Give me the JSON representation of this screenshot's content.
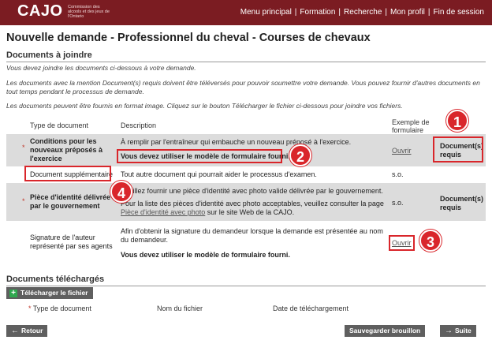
{
  "header": {
    "logo": "CAJO",
    "logo_sub": "Commission des alcools et des jeux de l'Ontario",
    "nav": [
      "Menu principal",
      "Formation",
      "Recherche",
      "Mon profil",
      "Fin de session"
    ],
    "separator": "|"
  },
  "page_title": "Nouvelle demande - Professionnel du cheval - Courses de chevaux",
  "documents": {
    "section_title": "Documents à joindre",
    "intro1": "Vous devez joindre les documents ci-dessous à votre demande.",
    "intro2": "Les documents avec la mention Document(s) requis doivent être téléversés pour pouvoir soumettre votre demande. Vous pouvez fournir d'autres documents en tout temps pendant le processus de demande.",
    "intro3": "Les documents peuvent être fournis en format image. Cliquez sur le bouton Télécharger le fichier ci-dessous pour joindre vos fichiers.",
    "headers": {
      "type": "Type de document",
      "description": "Description",
      "example": "Exemple de formulaire"
    },
    "rows": [
      {
        "star": "*",
        "type": "Conditions pour les nouveaux préposés à l'exercice",
        "desc1": "À remplir par l'entraîneur qui embauche un nouveau préposé à l'exercice.",
        "desc2": "Vous devez utiliser le modèle de formulaire fourni.",
        "example": "Ouvrir",
        "status": "Document(s) requis"
      },
      {
        "type": "Document supplémentaire",
        "desc1": "Tout autre document qui pourrait aider le processus d'examen.",
        "example": "s.o."
      },
      {
        "star": "*",
        "type": "Pièce d'identité délivrée par le gouvernement",
        "desc1": "Veuillez fournir une pièce d'identité avec photo valide délivrée par le gouvernement.",
        "desc2a": "Pour la liste des pièces d'identité avec photo acceptables, veuillez consulter la page ",
        "desc2_link": "Pièce d'identité avec photo",
        "desc2b": " sur le site Web de la CAJO.",
        "example": "s.o.",
        "status": "Document(s) requis"
      },
      {
        "type": "Signature de l'auteur représenté par ses agents",
        "desc1": "Afin d'obtenir la signature du demandeur lorsque la demande est présentée au nom du demandeur.",
        "desc2": "Vous devez utiliser le modèle de formulaire fourni.",
        "example": "Ouvrir"
      }
    ]
  },
  "uploaded": {
    "section_title": "Documents téléchargés",
    "upload_button": "Télécharger le fichier",
    "headers": {
      "star": "*",
      "type": "Type de document",
      "filename": "Nom du fichier",
      "date": "Date de téléchargement"
    }
  },
  "footer": {
    "back": "Retour",
    "save": "Sauvegarder brouillon",
    "next": "Suite"
  },
  "badges": [
    "1",
    "2",
    "3",
    "4"
  ],
  "colors": {
    "header_bg": "#7b1c22",
    "highlight": "#d9262b",
    "button_bg": "#5f5f5f",
    "row_gray": "#dcdcdc"
  }
}
